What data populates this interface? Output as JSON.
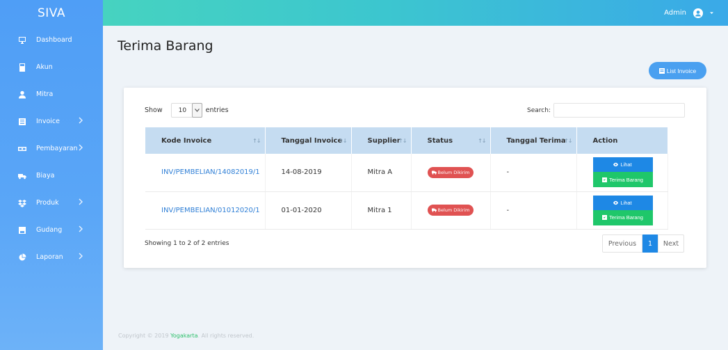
{
  "app": {
    "brand": "SIVA"
  },
  "sidebar": {
    "items": [
      {
        "label": "Dashboard",
        "icon": "monitor-icon",
        "chevron": false
      },
      {
        "label": "Akun",
        "icon": "calculator-icon",
        "chevron": false
      },
      {
        "label": "Mitra",
        "icon": "user-icon",
        "chevron": false
      },
      {
        "label": "Invoice",
        "icon": "list-icon",
        "chevron": true
      },
      {
        "label": "Pembayaran",
        "icon": "money-icon",
        "chevron": true
      },
      {
        "label": "Biaya",
        "icon": "truck-icon",
        "chevron": false
      },
      {
        "label": "Produk",
        "icon": "dropbox-icon",
        "chevron": true
      },
      {
        "label": "Gudang",
        "icon": "warehouse-icon",
        "chevron": true
      },
      {
        "label": "Laporan",
        "icon": "pie-chart-icon",
        "chevron": true
      }
    ]
  },
  "topbar": {
    "user": "Admin"
  },
  "page": {
    "title": "Terima Barang",
    "list_invoice_label": "List Invoice"
  },
  "table_controls": {
    "show_label": "Show",
    "entries_value": "10",
    "entries_label": "entries",
    "search_label": "Search:"
  },
  "table": {
    "headers": [
      "Kode Invoice",
      "Tanggal Invoice",
      "Supplier",
      "Status",
      "Tanggal Terima",
      "Action"
    ],
    "rows": [
      {
        "kode": "INV/PEMBELIAN/14082019/1",
        "tanggal": "14-08-2019",
        "supplier": "Mitra A",
        "status": "Belum Dikirim",
        "terima": "-",
        "lihat": "Lihat",
        "terima_btn": "Terima Barang"
      },
      {
        "kode": "INV/PEMBELIAN/01012020/1",
        "tanggal": "01-01-2020",
        "supplier": "Mitra 1",
        "status": "Belum Dikirim",
        "terima": "-",
        "lihat": "Lihat",
        "terima_btn": "Terima Barang"
      }
    ]
  },
  "pagination": {
    "info": "Showing 1 to 2 of 2 entries",
    "previous": "Previous",
    "current": "1",
    "next": "Next"
  },
  "footer": {
    "prefix": "Copyright © 2019 ",
    "brand": "Yogakarta",
    "suffix": ". All rights reserved."
  },
  "colors": {
    "sidebar": "#5aa6f7",
    "primary": "#1e88e5",
    "success": "#1fc76a",
    "danger": "#e05252",
    "header_row": "#c5dcf1"
  }
}
